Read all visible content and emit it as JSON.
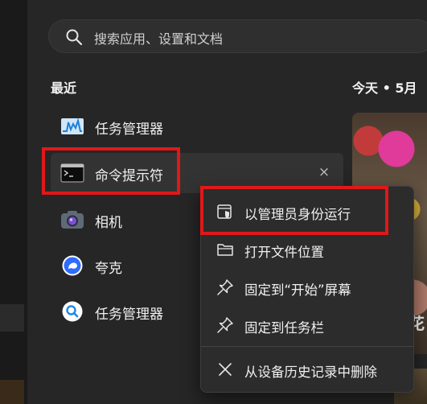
{
  "search": {
    "placeholder": "搜索应用、设置和文档"
  },
  "recent": {
    "title": "最近",
    "items": [
      {
        "label": "任务管理器",
        "icon": "task-manager-icon"
      },
      {
        "label": "命令提示符",
        "icon": "command-prompt-icon"
      },
      {
        "label": "相机",
        "icon": "camera-icon"
      },
      {
        "label": "夸克",
        "icon": "quark-icon"
      },
      {
        "label": "任务管理器",
        "icon": "search-app-icon"
      }
    ],
    "close_glyph": "×"
  },
  "widget": {
    "header": "今天 • 5月",
    "glyph": "花"
  },
  "context_menu": {
    "items": [
      {
        "label": "以管理员身份运行",
        "icon": "shield-admin-icon"
      },
      {
        "label": "打开文件位置",
        "icon": "folder-icon"
      },
      {
        "label": "固定到“开始”屏幕",
        "icon": "pin-icon"
      },
      {
        "label": "固定到任务栏",
        "icon": "pin-icon"
      },
      {
        "label": "从设备历史记录中删除",
        "icon": "close-icon"
      }
    ]
  },
  "colors": {
    "highlight": "#e01818",
    "panel": "#262626",
    "menu": "#2c2c2c"
  }
}
